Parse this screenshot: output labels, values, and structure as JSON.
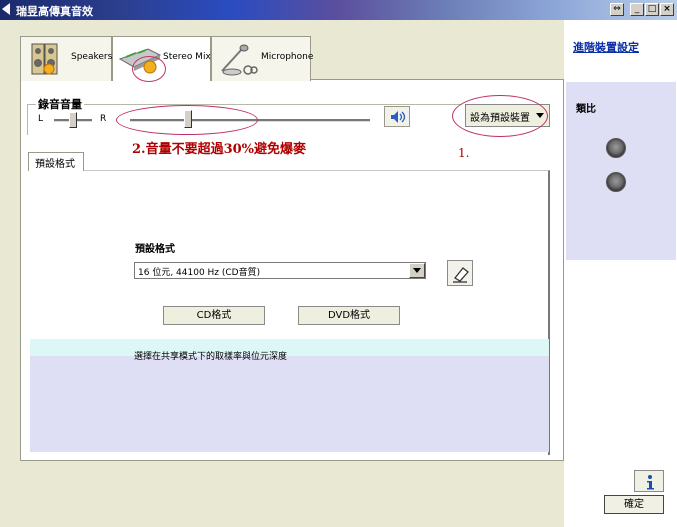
{
  "window": {
    "title": "瑞昱高傳真音效",
    "restore_glyph": "⇔",
    "min_glyph": "_",
    "max_glyph": "□",
    "close_glyph": "×"
  },
  "tabs": [
    {
      "label": "Speakers",
      "icon": "speaker-icon"
    },
    {
      "label": "Stereo Mix",
      "icon": "mixer-icon"
    },
    {
      "label": "Microphone",
      "icon": "microphone-icon"
    }
  ],
  "recording": {
    "group_label": "錄音音量",
    "left_label": "L",
    "right_label": "R",
    "balance_fraction": 0.5,
    "volume_fraction": 0.24
  },
  "set_default_label": "設為預設裝置",
  "annotations": {
    "volume_note": "2.音量不要超過30%避免爆麥",
    "step_one": "1."
  },
  "sub_tab_label": "預設格式",
  "format": {
    "heading": "預設格式",
    "selected": "16 位元, 44100 Hz (CD音質)",
    "cd_button": "CD格式",
    "dvd_button": "DVD格式",
    "description": "選擇在共享模式下的取樣率與位元深度"
  },
  "right": {
    "advanced_link": "進階裝置設定",
    "section_label": "類比"
  },
  "footer": {
    "info_icon": "info-icon",
    "ok_label": "確定"
  },
  "colors": {
    "annotation": "#b00000",
    "ellipse": "#c0306a",
    "link": "#0b2ea8"
  }
}
